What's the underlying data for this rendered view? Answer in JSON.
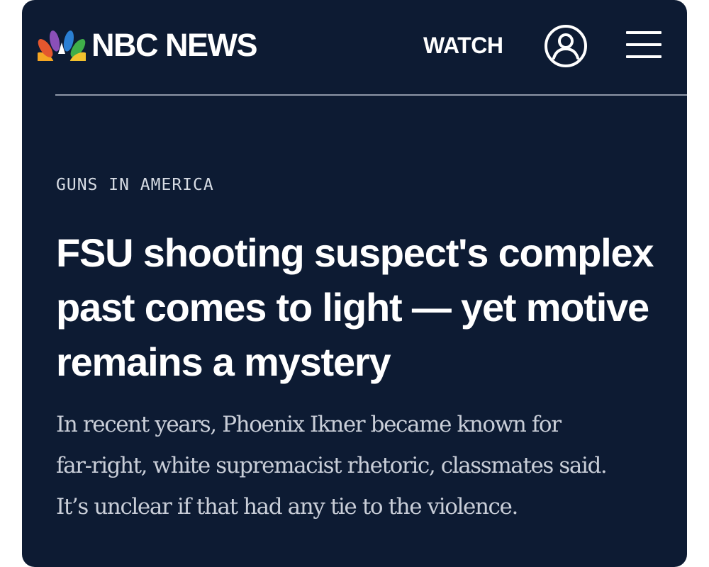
{
  "header": {
    "brand_name": "NBC NEWS",
    "logo_icon": "nbc-peacock-icon",
    "watch_label": "WATCH",
    "account_icon": "user-account-icon",
    "menu_icon": "hamburger-menu-icon"
  },
  "article": {
    "section_label": "GUNS IN AMERICA",
    "headline": "FSU shooting suspect's complex past comes to light — yet motive remains a mystery",
    "dek_lines": [
      "In recent years, Phoenix Ikner became known for",
      "far-right, white supremacist rhetoric, classmates said.",
      "It’s unclear if that had any tie to the violence."
    ]
  },
  "colors": {
    "background": "#0d1b33",
    "text_primary": "#ffffff",
    "text_secondary": "#c9ced8",
    "divider": "#8f98a8",
    "peacock": [
      "#f5a623",
      "#e4572e",
      "#8a4fb8",
      "#2a7fd4",
      "#3fae49",
      "#f2c12e"
    ]
  }
}
